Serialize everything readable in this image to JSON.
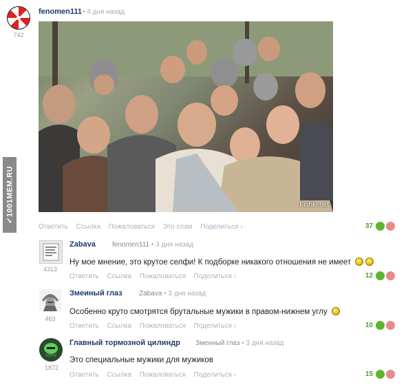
{
  "post": {
    "author": "fenomen111",
    "author_rating": "742",
    "time": "4 дня назад",
    "image_watermark": "Fishki.net",
    "actions": [
      "Ответить",
      "Ссылка",
      "Пожаловаться",
      "Это спам",
      "Поделиться ›"
    ],
    "votes": "37"
  },
  "side_watermark": "✔1001MEM.RU",
  "comments": [
    {
      "author": "Zabava",
      "author_rating": "4313",
      "reply_to": "fenomen111",
      "time": "3 дня назад",
      "text": "Ну мое мнение, это крутое селфи! К подборке никакого отношения не имеет",
      "smileys": 2,
      "actions": [
        "Ответить",
        "Ссылка",
        "Пожаловаться",
        "Поделиться ›"
      ],
      "votes": "12"
    },
    {
      "author": "Змеиный глаз",
      "author_rating": "463",
      "reply_to": "Zabava",
      "time": "3 дня назад",
      "text": "Особенно круто смотрятся брутальные мужики в правом-нижнем углу",
      "smileys": 1,
      "actions": [
        "Ответить",
        "Ссылка",
        "Пожаловаться",
        "Поделиться ›"
      ],
      "votes": "10"
    },
    {
      "author": "Главный тормозной цилиндр",
      "author_rating": "1872",
      "reply_to": "Змеиный глаз",
      "time": "3 дня назад",
      "text": "Это специальные мужики для мужиков",
      "smileys": 0,
      "actions": [
        "Ответить",
        "Ссылка",
        "Пожаловаться",
        "Поделиться ›"
      ],
      "votes": "15"
    }
  ],
  "colors": {
    "username": "#1b3a6b",
    "vote_up": "#5ab62e",
    "vote_down": "#e88a8a",
    "link": "#aab4c0"
  }
}
